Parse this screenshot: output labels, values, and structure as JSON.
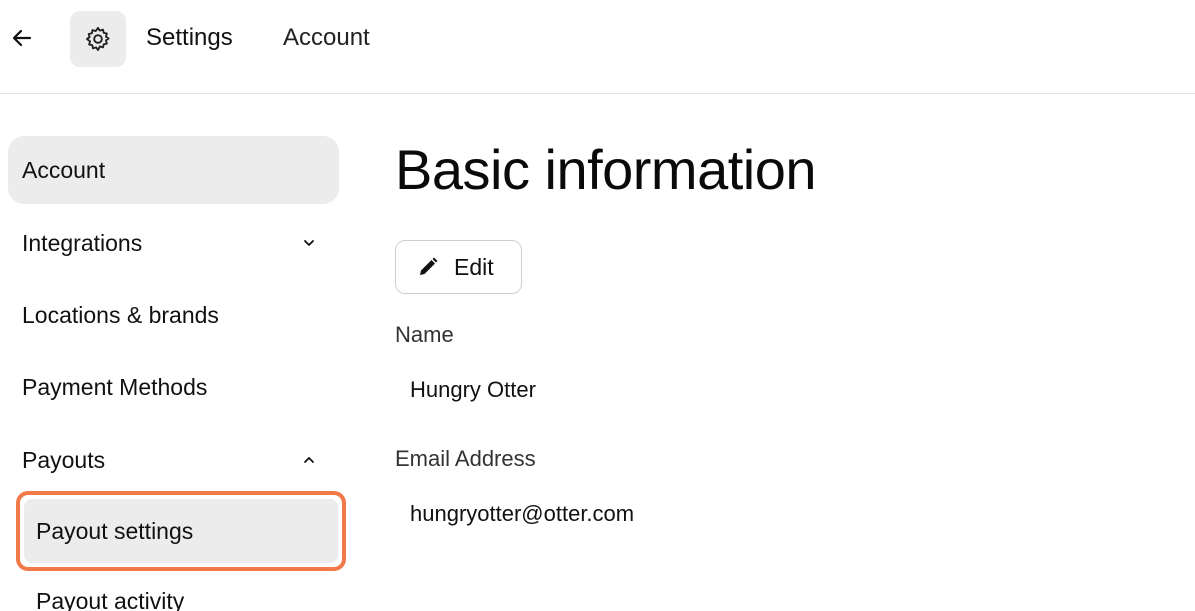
{
  "header": {
    "back_icon": "arrow-left-icon",
    "settings_icon": "gear-icon",
    "breadcrumb": [
      "Settings",
      "Account"
    ]
  },
  "sidebar": {
    "items": [
      {
        "label": "Account",
        "active": true
      },
      {
        "label": "Integrations",
        "chevron": "chevron-down-icon"
      },
      {
        "label": "Locations & brands"
      },
      {
        "label": "Payment Methods"
      },
      {
        "label": "Payouts",
        "chevron": "chevron-up-icon"
      }
    ],
    "sub_items": [
      {
        "label": "Payout settings",
        "highlighted": true
      },
      {
        "label": "Payout activity"
      }
    ]
  },
  "main": {
    "title": "Basic information",
    "edit_label": "Edit",
    "edit_icon": "pencil-icon",
    "fields": [
      {
        "label": "Name",
        "value": "Hungry Otter"
      },
      {
        "label": "Email Address",
        "value": "hungryotter@otter.com"
      }
    ]
  },
  "colors": {
    "highlight_border": "#f27a4a",
    "active_bg": "#ececec"
  }
}
